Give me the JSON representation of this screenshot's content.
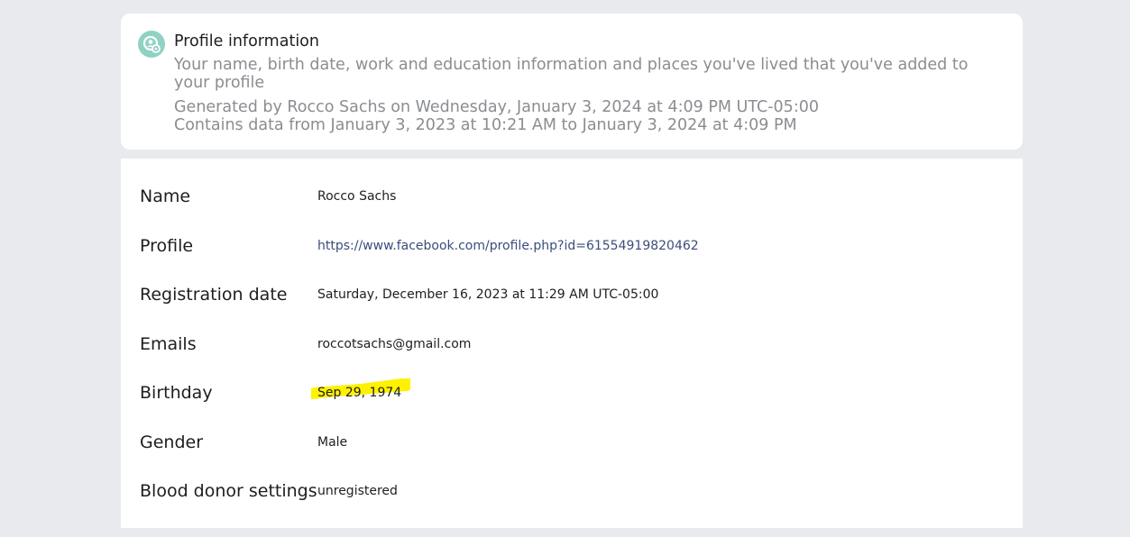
{
  "header": {
    "icon": "privacy-checkup-icon",
    "icon_color": "#8fd2c4",
    "title": "Profile information",
    "description": "Your name, birth date, work and education information and places you've lived that you've added to your profile",
    "generated_by": "Generated by Rocco Sachs on Wednesday, January 3, 2024 at 4:09 PM UTC-05:00",
    "date_range": "Contains data from January 3, 2023 at 10:21 AM to January 3, 2024 at 4:09 PM"
  },
  "profile": {
    "rows": [
      {
        "label": "Name",
        "value": "Rocco Sachs"
      },
      {
        "label": "Profile",
        "value": "https://www.facebook.com/profile.php?id=61554919820462"
      },
      {
        "label": "Registration date",
        "value": "Saturday, December 16, 2023 at 11:29 AM UTC-05:00"
      },
      {
        "label": "Emails",
        "value": "roccotsachs@gmail.com"
      },
      {
        "label": "Birthday",
        "value": "Sep 29, 1974"
      },
      {
        "label": "Gender",
        "value": "Male"
      },
      {
        "label": "Blood donor settings",
        "value": "unregistered"
      }
    ]
  },
  "colors": {
    "background": "#e9eaee",
    "card": "#ffffff",
    "highlight": "#fff200",
    "link": "#3b4d7a"
  }
}
